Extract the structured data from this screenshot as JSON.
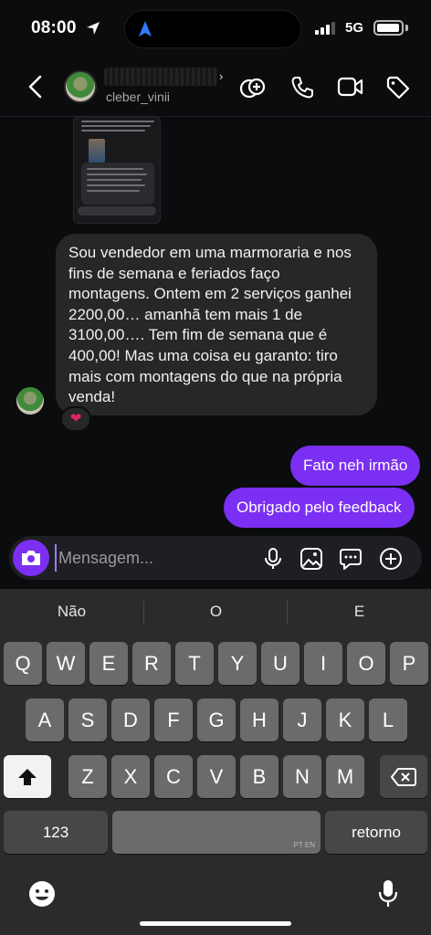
{
  "status_bar": {
    "time": "08:00",
    "network": "5G",
    "battery_level": 0.85,
    "signal_bars": 3
  },
  "header": {
    "username": "cleber_vinii",
    "name_chevron": "›"
  },
  "messages": {
    "incoming_text": "Sou vendedor em uma marmoraria e nos fins de semana e feriados faço montagens. Ontem em 2 serviços ganhei 2200,00… amanhã tem mais 1 de 3100,00…. Tem fim de semana que é 400,00! Mas uma coisa eu garanto: tiro mais com montagens do que na própria venda!",
    "incoming_reaction": "❤",
    "outgoing": [
      "Fato neh irmão",
      "Obrigado pelo feedback"
    ]
  },
  "composer": {
    "placeholder": "Mensagem..."
  },
  "keyboard": {
    "suggestions": [
      "Não",
      "O",
      "E"
    ],
    "row1": [
      "Q",
      "W",
      "E",
      "R",
      "T",
      "Y",
      "U",
      "I",
      "O",
      "P"
    ],
    "row2": [
      "A",
      "S",
      "D",
      "F",
      "G",
      "H",
      "J",
      "K",
      "L"
    ],
    "row3": [
      "Z",
      "X",
      "C",
      "V",
      "B",
      "N",
      "M"
    ],
    "numbers_key": "123",
    "space_sub": "PT EN",
    "return_key": "retorno"
  },
  "colors": {
    "accent": "#7b2ff2",
    "bubble_in": "#262729",
    "background": "#0b0c0e",
    "keyboard": "#2b2b2d"
  }
}
